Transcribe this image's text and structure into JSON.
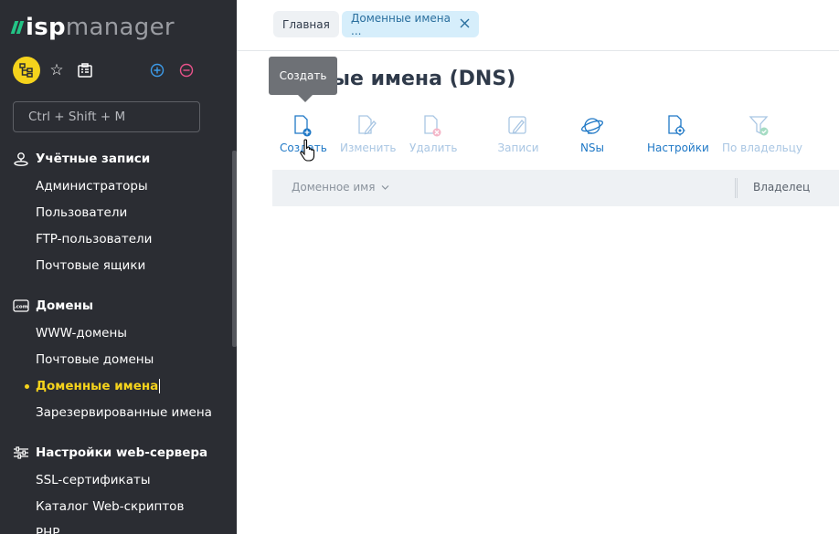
{
  "app": {
    "logo_isp": "isp",
    "logo_manager": "manager"
  },
  "sidebar": {
    "search_placeholder": "Ctrl + Shift + M",
    "tools": [
      "tree-icon",
      "star-icon",
      "clipboard-icon",
      "plus-circle-icon",
      "minus-circle-icon"
    ],
    "groups": [
      {
        "title": "Учётные записи",
        "icon": "user-pin-icon",
        "items": [
          "Администраторы",
          "Пользователи",
          "FTP-пользователи",
          "Почтовые ящики"
        ]
      },
      {
        "title": "Домены",
        "icon": "domain-com-icon",
        "items": [
          "WWW-домены",
          "Почтовые домены",
          "Доменные имена",
          "Зарезервированные имена"
        ]
      },
      {
        "title": "Настройки web-сервера",
        "icon": "sliders-icon",
        "items": [
          "SSL-сертификаты",
          "Каталог Web-скриптов",
          "PHP"
        ]
      }
    ],
    "active_item": "Доменные имена"
  },
  "breadcrumbs": {
    "home": "Главная",
    "current": "Доменные имена ..."
  },
  "page": {
    "title": "Доменные имена (DNS)",
    "title_visible": "нные имена (DNS)"
  },
  "toolbar": {
    "buttons": [
      {
        "label": "Создать",
        "icon": "file-plus-icon",
        "enabled": true
      },
      {
        "label": "Изменить",
        "icon": "file-edit-icon",
        "enabled": false
      },
      {
        "label": "Удалить",
        "icon": "file-delete-icon",
        "enabled": false
      },
      {
        "label": "Записи",
        "icon": "records-edit-icon",
        "enabled": false
      },
      {
        "label": "NSы",
        "icon": "globe-icon",
        "enabled": true
      },
      {
        "label": "Настройки",
        "icon": "file-gear-icon",
        "enabled": true
      },
      {
        "label": "По владельцу",
        "icon": "filter-check-icon",
        "enabled": false
      }
    ]
  },
  "table": {
    "columns": [
      "Доменное имя",
      "Владелец"
    ]
  },
  "tooltip": {
    "text": "Создать"
  },
  "colors": {
    "sidebar_bg": "#2b2d33",
    "accent_yellow": "#f5d31c",
    "accent_blue": "#1f78c6",
    "logo_green": "#23c486"
  }
}
